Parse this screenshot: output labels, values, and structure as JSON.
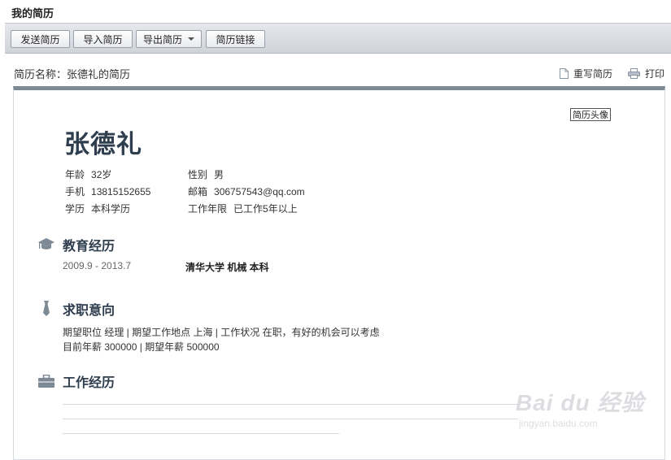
{
  "page": {
    "title": "我的简历"
  },
  "toolbar": {
    "send_label": "发送简历",
    "import_label": "导入简历",
    "export_label": "导出简历",
    "link_label": "简历链接"
  },
  "resume_bar": {
    "name_label": "简历名称：张德礼的简历",
    "rewrite_label": "重写简历",
    "print_label": "打印"
  },
  "resume": {
    "avatar_label": "简历头像",
    "name": "张德礼",
    "info": {
      "age_key": "年龄",
      "age_val": "32岁",
      "gender_key": "性别",
      "gender_val": "男",
      "phone_key": "手机",
      "phone_val": "13815152655",
      "email_key": "邮箱",
      "email_val": "306757543@qq.com",
      "edu_key": "学历",
      "edu_val": "本科学历",
      "years_key": "工作年限",
      "years_val": "已工作5年以上"
    },
    "education": {
      "title": "教育经历",
      "date": "2009.9 - 2013.7",
      "detail": "清华大学 机械 本科"
    },
    "intent": {
      "title": "求职意向",
      "line1": "期望职位 经理 | 期望工作地点 上海 | 工作状况 在职，有好的机会可以考虑",
      "line2": "目前年薪 300000 | 期望年薪 500000"
    },
    "work": {
      "title": "工作经历"
    }
  },
  "watermark": {
    "logo": "Bai du 经验",
    "url": "jingyan.baidu.com"
  },
  "icons": [
    "graduation-cap-icon",
    "tie-icon",
    "briefcase-icon",
    "document-icon",
    "printer-icon",
    "dropdown-caret-icon"
  ]
}
